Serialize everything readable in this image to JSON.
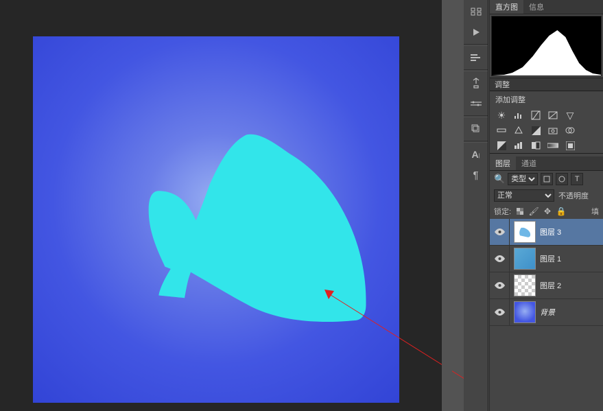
{
  "top_tabs": {
    "histogram": "直方图",
    "info": "信息"
  },
  "adjustments": {
    "panel_title": "调整",
    "add_title": "添加调整"
  },
  "layers_panel": {
    "tab_layers": "图层",
    "tab_channels": "通道",
    "filter_label": "类型",
    "blend_mode": "正常",
    "opacity_label": "不透明度",
    "lock_label": "锁定:",
    "fill_label": "填"
  },
  "layers": [
    {
      "name": "图层 3",
      "selected": true,
      "thumb": "shoe"
    },
    {
      "name": "图层 1",
      "selected": false,
      "thumb": "tex"
    },
    {
      "name": "图层 2",
      "selected": false,
      "thumb": "checker"
    },
    {
      "name": "背景",
      "selected": false,
      "thumb": "bg",
      "bg": true
    }
  ]
}
